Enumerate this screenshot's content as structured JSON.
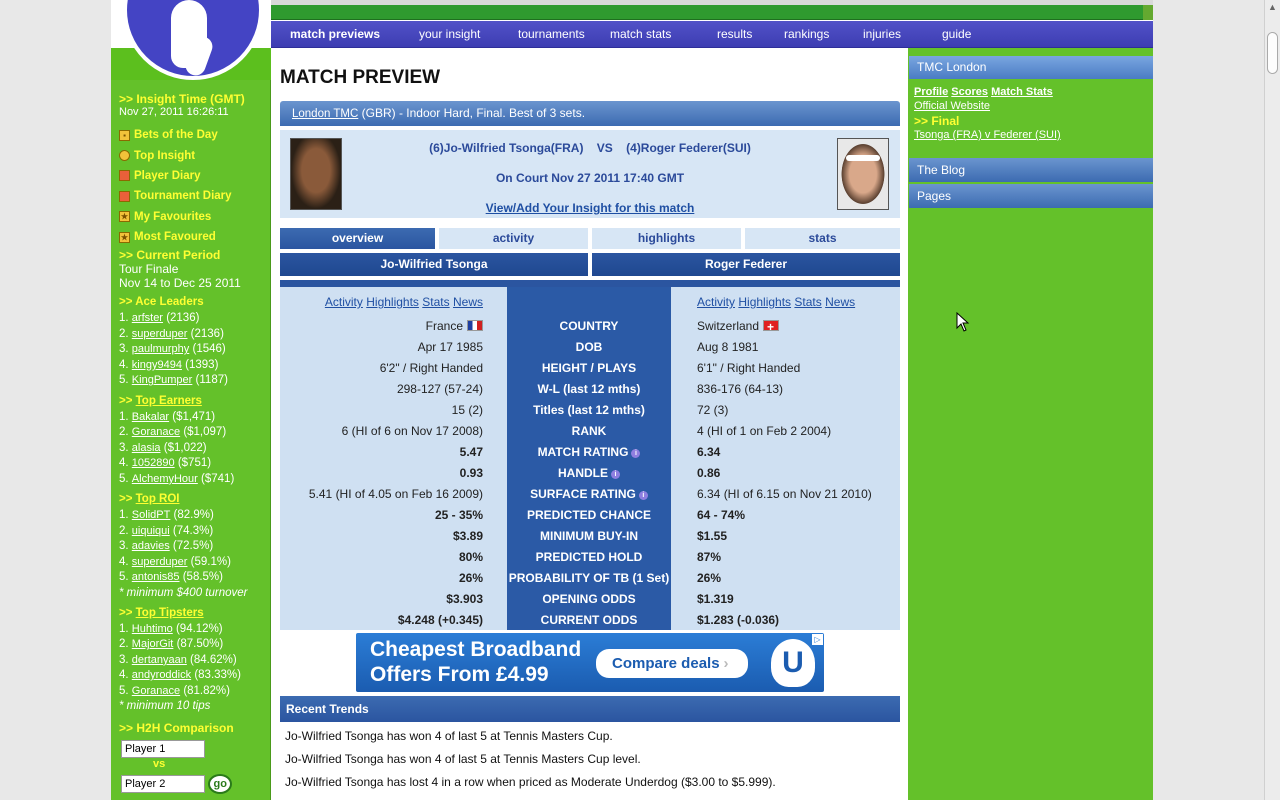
{
  "nav": {
    "items": [
      "match previews",
      "your insight",
      "tournaments",
      "match stats",
      "results",
      "rankings",
      "injuries",
      "guide"
    ]
  },
  "left": {
    "insight_time_label": ">> Insight Time (GMT)",
    "insight_time_value": "Nov 27, 2011 16:26:11",
    "menu": [
      "Bets of the Day",
      "Top Insight",
      "Player Diary",
      "Tournament Diary",
      "My Favourites",
      "Most Favoured"
    ],
    "current_period_label": ">> Current Period",
    "current_period_name": "Tour Finale",
    "current_period_dates": "Nov 14 to Dec 25 2011",
    "ace_leaders_label": ">> Ace Leaders",
    "ace_leaders": [
      {
        "rank": "1.",
        "name": "arfster",
        "value": "(2136)"
      },
      {
        "rank": "2.",
        "name": "superduper",
        "value": "(2136)"
      },
      {
        "rank": "3.",
        "name": "paulmurphy",
        "value": "(1546)"
      },
      {
        "rank": "4.",
        "name": "kingy9494",
        "value": "(1393)"
      },
      {
        "rank": "5.",
        "name": "KingPumper",
        "value": "(1187)"
      }
    ],
    "top_earners_prefix": ">> ",
    "top_earners_label": "Top Earners",
    "top_earners": [
      {
        "rank": "1.",
        "name": "Bakalar",
        "value": "($1,471)"
      },
      {
        "rank": "2.",
        "name": "Goranace",
        "value": "($1,097)"
      },
      {
        "rank": "3.",
        "name": "alasia",
        "value": "($1,022)"
      },
      {
        "rank": "4.",
        "name": "1052890",
        "value": "($751)"
      },
      {
        "rank": "5.",
        "name": "AlchemyHour",
        "value": "($741)"
      }
    ],
    "top_roi_prefix": ">> ",
    "top_roi_label": "Top ROI",
    "top_roi": [
      {
        "rank": "1.",
        "name": "SolidPT",
        "value": "(82.9%)"
      },
      {
        "rank": "2.",
        "name": "uiquiqui",
        "value": "(74.3%)"
      },
      {
        "rank": "3.",
        "name": "adavies",
        "value": "(72.5%)"
      },
      {
        "rank": "4.",
        "name": "superduper",
        "value": "(59.1%)"
      },
      {
        "rank": "5.",
        "name": "antonis85",
        "value": "(58.5%)"
      }
    ],
    "roi_note": "* minimum $400 turnover",
    "top_tipsters_prefix": ">> ",
    "top_tipsters_label": "Top Tipsters",
    "top_tipsters": [
      {
        "rank": "1.",
        "name": "Huhtimo",
        "value": "(94.12%)"
      },
      {
        "rank": "2.",
        "name": "MajorGit",
        "value": "(87.50%)"
      },
      {
        "rank": "3.",
        "name": "dertanyaan",
        "value": "(84.62%)"
      },
      {
        "rank": "4.",
        "name": "andyroddick",
        "value": "(83.33%)"
      },
      {
        "rank": "5.",
        "name": "Goranace",
        "value": "(81.82%)"
      }
    ],
    "tipsters_note": "* minimum 10 tips",
    "h2h_label": ">> H2H Comparison",
    "player1_value": "Player 1",
    "vs": "vs",
    "player2_value": "Player 2",
    "go_label": "go"
  },
  "main": {
    "title": "MATCH PREVIEW",
    "event_link": "London TMC",
    "event_desc": " (GBR) - Indoor Hard, Final. Best of 3 sets.",
    "matchup": "(6)Jo-Wilfried Tsonga(FRA)    VS    (4)Roger Federer(SUI)",
    "court": "On Court Nov 27 2011 17:40 GMT",
    "insight_link": "View/Add Your Insight for this match",
    "tabs": [
      "overview",
      "activity",
      "highlights",
      "stats"
    ],
    "player1": "Jo-Wilfried Tsonga",
    "player2": "Roger Federer",
    "player_links": [
      "Activity",
      "Highlights",
      "Stats",
      "News"
    ],
    "rows": [
      {
        "label": "COUNTRY",
        "p1": "France",
        "p2": "Switzerland",
        "info": false,
        "bold": false
      },
      {
        "label": "DOB",
        "p1": "Apr 17 1985",
        "p2": "Aug 8 1981",
        "info": false,
        "bold": false
      },
      {
        "label": "HEIGHT / PLAYS",
        "p1": "6'2\" / Right Handed",
        "p2": "6'1\" / Right Handed",
        "info": false,
        "bold": false
      },
      {
        "label": "W-L (last 12 mths)",
        "p1": "298-127 (57-24)",
        "p2": "836-176 (64-13)",
        "info": false,
        "bold": false
      },
      {
        "label": "Titles (last 12 mths)",
        "p1": "15 (2)",
        "p2": "72 (3)",
        "info": false,
        "bold": false
      },
      {
        "label": "RANK",
        "p1": "6 (HI of 6 on Nov 17 2008)",
        "p2": "4 (HI of 1 on Feb 2 2004)",
        "info": false,
        "bold": false
      },
      {
        "label": "MATCH RATING",
        "p1": "5.47",
        "p2": "6.34",
        "info": true,
        "bold": true
      },
      {
        "label": "HANDLE",
        "p1": "0.93",
        "p2": "0.86",
        "info": true,
        "bold": true
      },
      {
        "label": "SURFACE RATING",
        "p1": "5.41 (HI of 4.05 on Feb 16 2009)",
        "p2": "6.34 (HI of 6.15 on Nov 21 2010)",
        "info": true,
        "bold": false
      },
      {
        "label": "PREDICTED CHANCE",
        "p1": "25 - 35%",
        "p2": "64 - 74%",
        "info": false,
        "bold": true
      },
      {
        "label": "MINIMUM BUY-IN",
        "p1": "$3.89",
        "p2": "$1.55",
        "info": false,
        "bold": true
      },
      {
        "label": "PREDICTED HOLD",
        "p1": "80%",
        "p2": "87%",
        "info": false,
        "bold": true
      },
      {
        "label": "PROBABILITY OF TB (1 Set)",
        "p1": "26%",
        "p2": "26%",
        "info": false,
        "bold": true
      },
      {
        "label": "OPENING ODDS",
        "p1": "$3.903",
        "p2": "$1.319",
        "info": false,
        "bold": true
      },
      {
        "label": "CURRENT ODDS",
        "p1": "$4.248 (+0.345)",
        "p2": "$1.283 (-0.036)",
        "info": false,
        "bold": true
      }
    ],
    "ad_line1": "Cheapest Broadband",
    "ad_line2": "Offers From £4.99",
    "ad_button": "Compare deals",
    "ad_logo": "U",
    "trends_title": "Recent Trends",
    "trends": [
      "Jo-Wilfried Tsonga has won 4 of last 5 at Tennis Masters Cup.",
      "Jo-Wilfried Tsonga has won 4 of last 5 at Tennis Masters Cup level.",
      "Jo-Wilfried Tsonga has lost 4 in a row when priced as Moderate Underdog ($3.00 to $5.999)."
    ]
  },
  "right": {
    "tmc_title": "TMC London",
    "links": [
      "Profile",
      "Scores",
      "Match Stats"
    ],
    "official": "Official Website",
    "final_label": ">> Final",
    "final_link": "Tsonga (FRA) v Federer (SUI)",
    "blog": "The Blog",
    "pages": "Pages"
  }
}
